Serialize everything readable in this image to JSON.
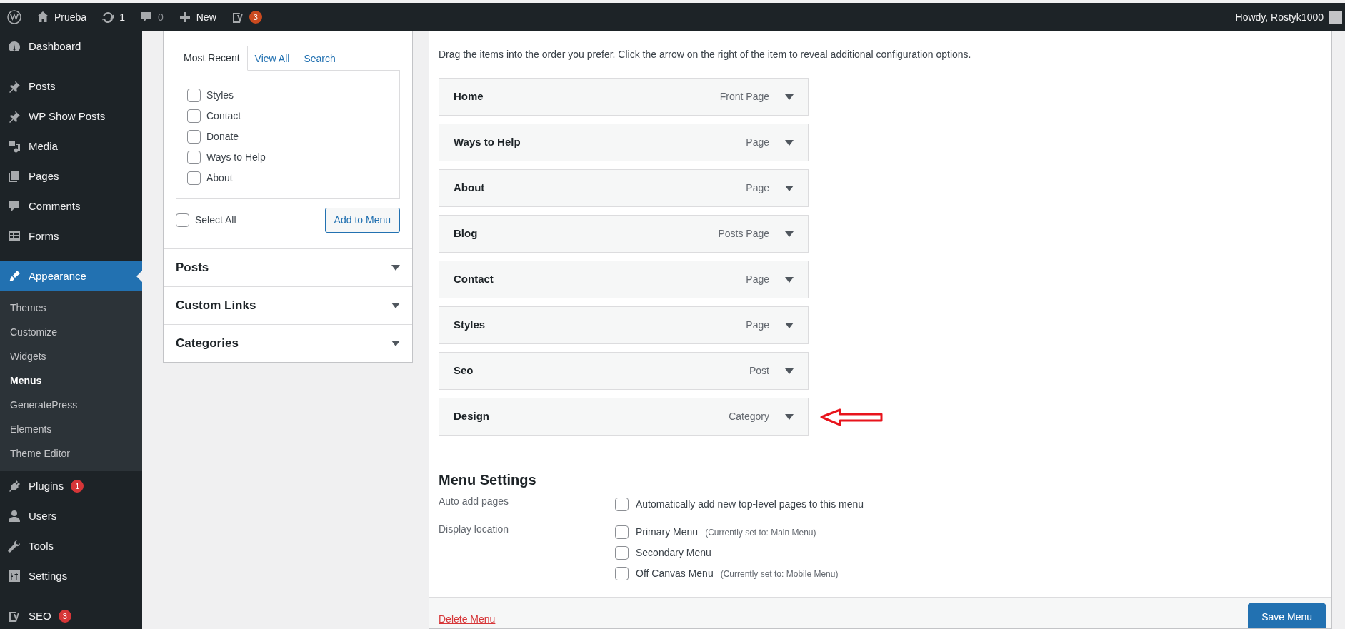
{
  "admin_bar": {
    "items": [
      {
        "label": "Prueba"
      },
      {
        "label": "1"
      },
      {
        "label": "0"
      },
      {
        "label": "New"
      },
      {
        "badge": "3"
      }
    ],
    "greeting": "Howdy, Rostyk1000"
  },
  "sidebar": {
    "items": [
      {
        "label": "Dashboard",
        "selected": false
      },
      {
        "label": "Posts",
        "selected": false
      },
      {
        "label": "WP Show Posts",
        "selected": false
      },
      {
        "label": "Media",
        "selected": false
      },
      {
        "label": "Pages",
        "selected": false
      },
      {
        "label": "Comments",
        "selected": false
      },
      {
        "label": "Forms",
        "selected": false
      },
      {
        "label": "Appearance",
        "selected": true,
        "children": [
          {
            "label": "Themes",
            "selected": false
          },
          {
            "label": "Customize",
            "selected": false
          },
          {
            "label": "Widgets",
            "selected": false
          },
          {
            "label": "Menus",
            "selected": true
          },
          {
            "label": "GeneratePress",
            "selected": false
          },
          {
            "label": "Elements",
            "selected": false
          },
          {
            "label": "Theme Editor",
            "selected": false
          }
        ]
      },
      {
        "label": "Plugins",
        "badge": "1",
        "selected": false
      },
      {
        "label": "Users",
        "selected": false
      },
      {
        "label": "Tools",
        "selected": false
      },
      {
        "label": "Settings",
        "selected": false
      },
      {
        "label": "SEO",
        "badge": "3",
        "selected": false
      }
    ]
  },
  "add_items": {
    "tabs": [
      {
        "label": "Most Recent",
        "selected": true
      },
      {
        "label": "View All",
        "selected": false
      },
      {
        "label": "Search",
        "selected": false
      }
    ],
    "pages": [
      {
        "label": "Styles",
        "checked": false
      },
      {
        "label": "Contact",
        "checked": false
      },
      {
        "label": "Donate",
        "checked": false
      },
      {
        "label": "Ways to Help",
        "checked": false
      },
      {
        "label": "About",
        "checked": false
      }
    ],
    "select_all": {
      "label": "Select All",
      "checked": false
    },
    "add_button": "Add to Menu",
    "sections": [
      {
        "title": "Posts",
        "expanded": false
      },
      {
        "title": "Custom Links",
        "expanded": false
      },
      {
        "title": "Categories",
        "expanded": false
      }
    ]
  },
  "menu_structure": {
    "instructions": "Drag the items into the order you prefer. Click the arrow on the right of the item to reveal additional configuration options.",
    "items": [
      {
        "title": "Home",
        "type": "Front Page"
      },
      {
        "title": "Ways to Help",
        "type": "Page"
      },
      {
        "title": "About",
        "type": "Page"
      },
      {
        "title": "Blog",
        "type": "Posts Page"
      },
      {
        "title": "Contact",
        "type": "Page"
      },
      {
        "title": "Styles",
        "type": "Page"
      },
      {
        "title": "Seo",
        "type": "Post"
      },
      {
        "title": "Design",
        "type": "Category",
        "annotated": true
      }
    ]
  },
  "menu_settings": {
    "title": "Menu Settings",
    "rows": [
      {
        "label": "Auto add pages",
        "options": [
          {
            "label": "Automatically add new top-level pages to this menu",
            "checked": false
          }
        ]
      },
      {
        "label": "Display location",
        "options": [
          {
            "label": "Primary Menu",
            "note": "(Currently set to: Main Menu)",
            "checked": false
          },
          {
            "label": "Secondary Menu",
            "checked": false
          },
          {
            "label": "Off Canvas Menu",
            "note": "(Currently set to: Mobile Menu)",
            "checked": false
          }
        ]
      }
    ]
  },
  "footer": {
    "delete_link": "Delete Menu",
    "save_button": "Save Menu"
  }
}
